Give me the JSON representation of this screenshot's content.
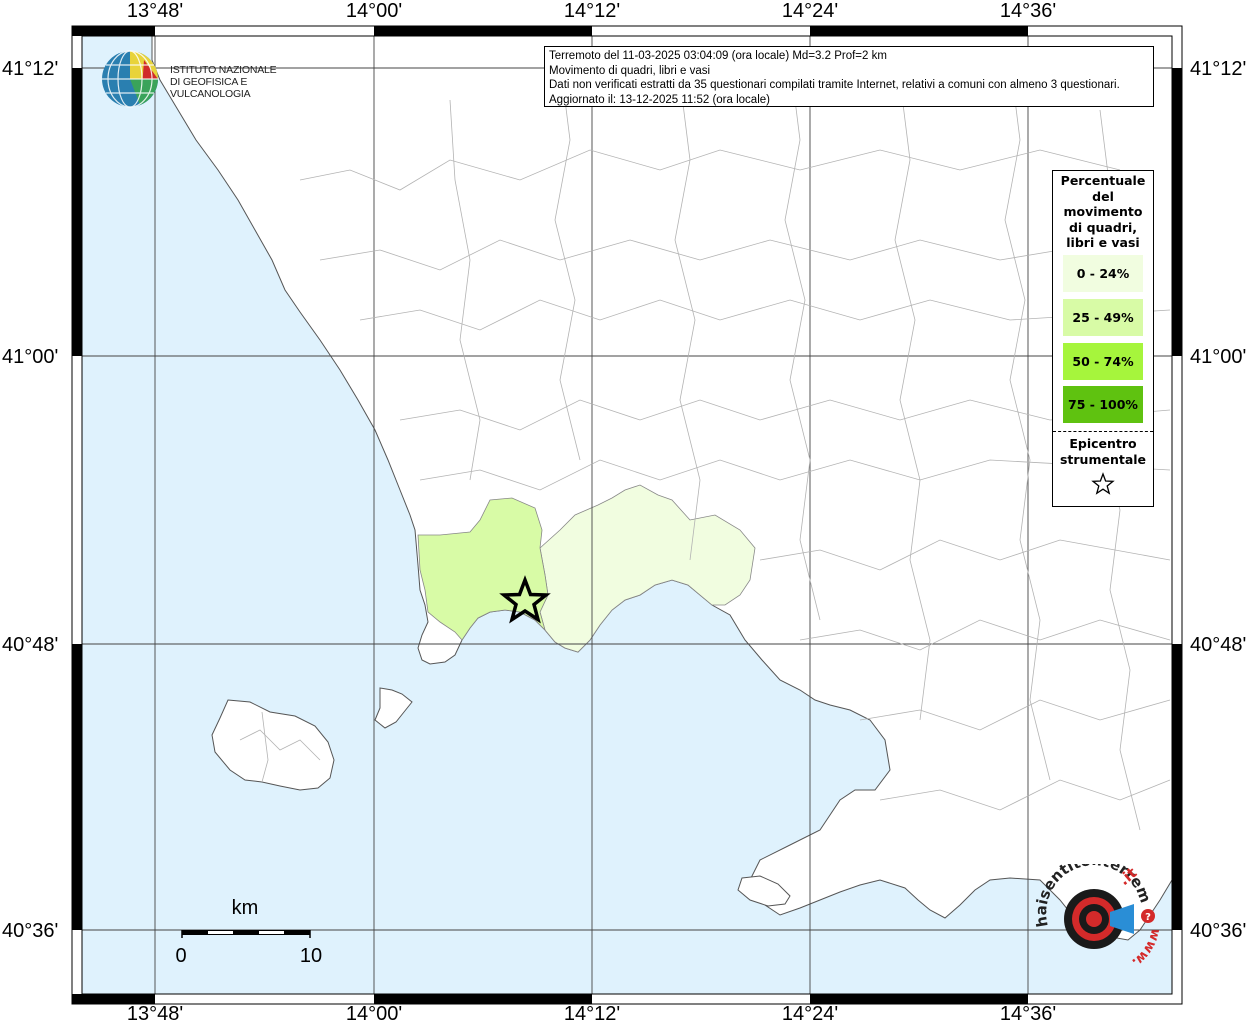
{
  "info": {
    "line1": "Terremoto del 11-03-2025 03:04:09 (ora locale) Md=3.2 Prof=2 km",
    "line2": "Movimento di quadri, libri e vasi",
    "line3": "Dati non verificati estratti da 35 questionari compilati tramite Internet, relativi a comuni con almeno 3 questionari.",
    "line4": "Aggiornato il: 13-12-2025 11:52 (ora locale)"
  },
  "ingv": {
    "line1": "ISTITUTO NAZIONALE",
    "line2": "DI GEOFISICA E VULCANOLOGIA"
  },
  "axes": {
    "top": [
      "13°48'",
      "14°00'",
      "14°12'",
      "14°24'",
      "14°36'"
    ],
    "bottom": [
      "13°48'",
      "14°00'",
      "14°12'",
      "14°24'",
      "14°36'"
    ],
    "left": [
      "41°12'",
      "41°00'",
      "40°48'",
      "40°36'"
    ],
    "right": [
      "41°12'",
      "41°00'",
      "40°48'",
      "40°36'"
    ]
  },
  "legend": {
    "title_lines": [
      "Percentuale",
      "del",
      "movimento",
      "di quadri,",
      "libri e vasi"
    ],
    "items": [
      {
        "label": "0 - 24%",
        "color": "#f1fde0"
      },
      {
        "label": "25 - 49%",
        "color": "#d8fba6"
      },
      {
        "label": "50 - 74%",
        "color": "#a6f53c"
      },
      {
        "label": "75 - 100%",
        "color": "#5fc210"
      }
    ],
    "epicenter_lines": [
      "Epicentro",
      "strumentale"
    ]
  },
  "scale": {
    "unit": "km",
    "min": "0",
    "max": "10"
  },
  "brand": {
    "text_main": "haisentitoilterremoto",
    "text_tld": ".it",
    "text_www": "www."
  },
  "colors": {
    "sea": "#dff2fd",
    "land": "#ffffff",
    "border": "#b3b3b3"
  }
}
